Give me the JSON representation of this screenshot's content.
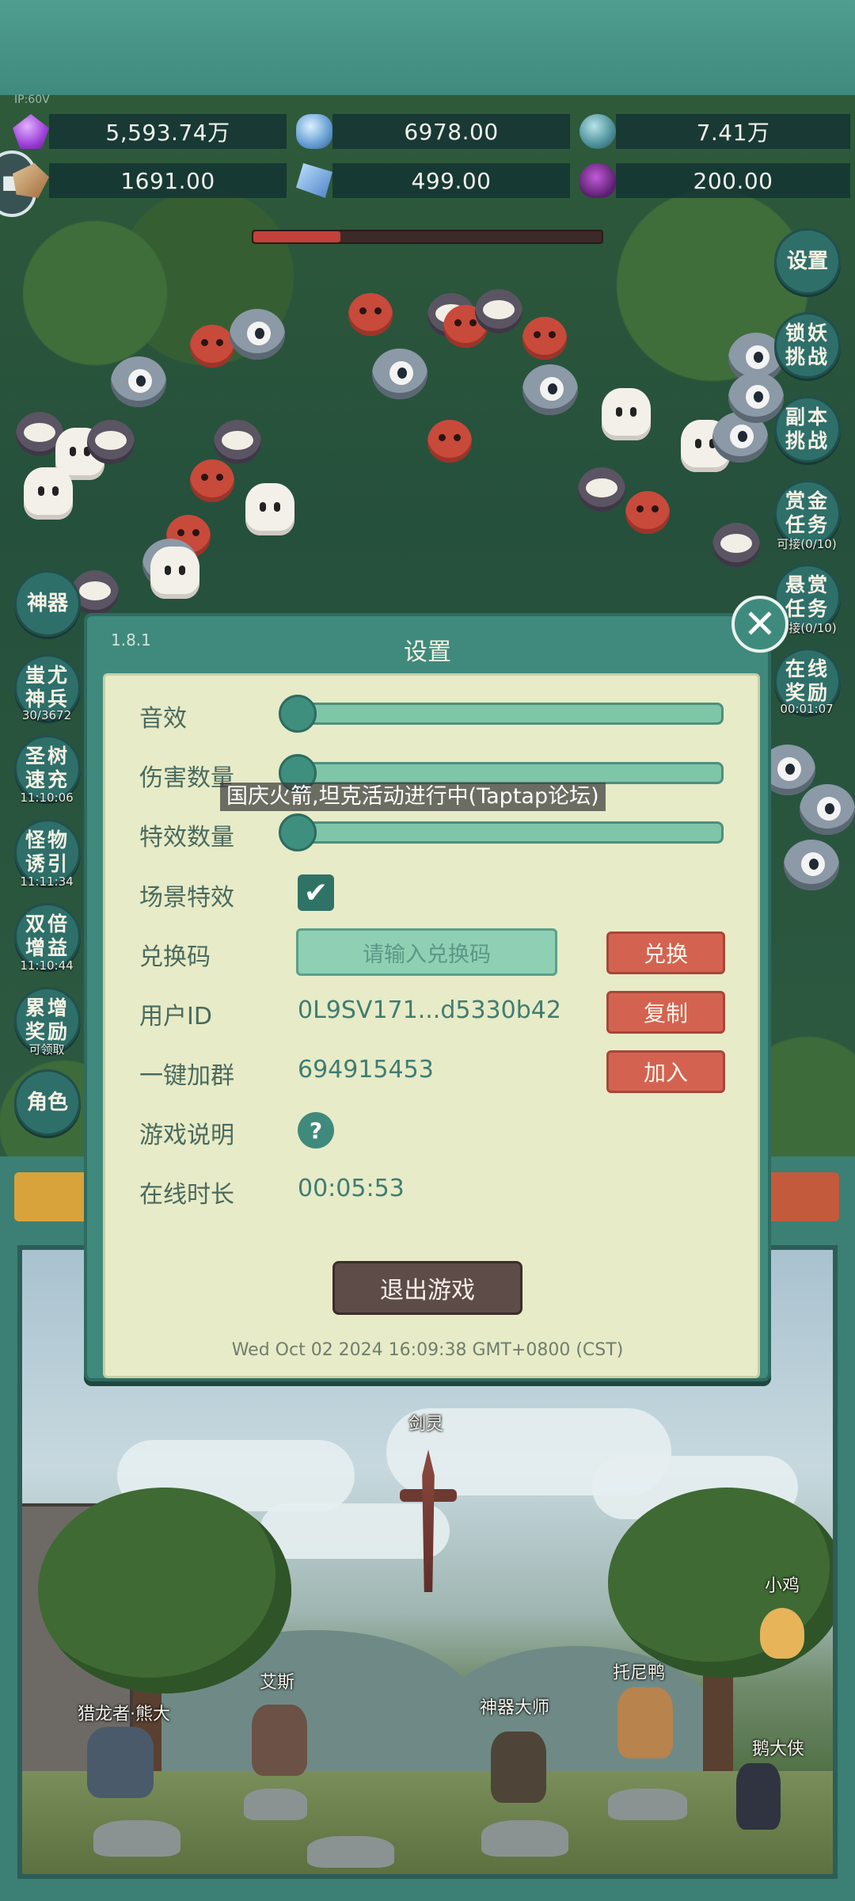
{
  "top": {
    "small_label": "IP:60V"
  },
  "resources": {
    "row1": [
      {
        "icon": "purple-gem-icon",
        "value": "5,593.74万"
      },
      {
        "icon": "blue-crystal-icon",
        "value": "6978.00"
      },
      {
        "icon": "globe-orb-icon",
        "value": "7.41万"
      }
    ],
    "row2": [
      {
        "icon": "scroll-icon",
        "value": "1691.00"
      },
      {
        "icon": "ice-shard-icon",
        "value": "499.00"
      },
      {
        "icon": "potion-pot-icon",
        "value": "200.00"
      }
    ]
  },
  "right_menu": [
    {
      "label": "设置"
    },
    {
      "label": "锁妖\n挑战"
    },
    {
      "label": "副本\n挑战"
    },
    {
      "label": "赏金\n任务",
      "sub": "可接(0/10)"
    },
    {
      "label": "悬赏\n任务",
      "sub": "可接(0/10)"
    },
    {
      "label": "在线\n奖励",
      "sub": "00:01:07"
    }
  ],
  "left_menu": [
    {
      "label": "神器"
    },
    {
      "label": "蚩尤\n神兵",
      "sub": "30/3672"
    },
    {
      "label": "圣树\n速充",
      "sub": "11:10:06"
    },
    {
      "label": "怪物\n诱引",
      "sub": "11:11:34"
    },
    {
      "label": "双倍\n增益",
      "sub": "11:10:44"
    },
    {
      "label": "累增\n奖励",
      "sub": "可领取"
    },
    {
      "label": "角色"
    }
  ],
  "dialog": {
    "version": "1.8.1",
    "title": "设置",
    "close_symbol": "✕",
    "sound_label": "音效",
    "damage_count_label": "伤害数量",
    "effect_count_label": "特效数量",
    "sliders": {
      "sound": 0.0,
      "damage_count": 0.0,
      "effect_count": 0.0
    },
    "scene_effects_label": "场景特效",
    "scene_effects_checked": true,
    "check_symbol": "✔",
    "redeem_label": "兑换码",
    "redeem_placeholder": "请输入兑换码",
    "redeem_button": "兑换",
    "user_id_label": "用户ID",
    "user_id_value": "0L9SV171...d5330b42",
    "copy_button": "复制",
    "group_label": "一键加群",
    "group_value": "694915453",
    "join_button": "加入",
    "guide_label": "游戏说明",
    "guide_symbol": "?",
    "online_label": "在线时长",
    "online_value": "00:05:53",
    "exit_button": "退出游戏",
    "datetime": "Wed Oct 02 2024 16:09:38 GMT+0800 (CST)"
  },
  "toast": "国庆火箭,坦克活动进行中(Taptap论坛)",
  "scene": {
    "heroes": [
      {
        "name": "剑灵"
      },
      {
        "name": "小鸡"
      },
      {
        "name": "艾斯"
      },
      {
        "name": "托尼鸭"
      },
      {
        "name": "猎龙者·熊大"
      },
      {
        "name": "神器大师"
      },
      {
        "name": "鹅大侠"
      }
    ]
  },
  "colors": {
    "panel_teal": "#3f8a7c",
    "dialog_cream": "#e7ebc7",
    "button_red": "#d36350",
    "exit_brown": "#5d4c48"
  }
}
